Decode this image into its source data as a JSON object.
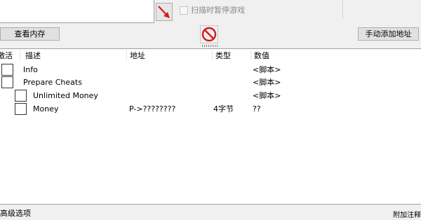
{
  "pause": {
    "label": "扫描时暂停游戏"
  },
  "buttons": {
    "memory_view": "查看内存",
    "add_address": "手动添加地址"
  },
  "columns": {
    "active": "激活",
    "description": "描述",
    "address": "地址",
    "type": "类型",
    "value": "数值"
  },
  "rows": [
    {
      "description": "Info",
      "address": "",
      "type": "",
      "value": "<脚本>",
      "indent": 0
    },
    {
      "description": "Prepare Cheats",
      "address": "",
      "type": "",
      "value": "<脚本>",
      "indent": 0
    },
    {
      "description": "Unlimited Money",
      "address": "",
      "type": "",
      "value": "<脚本>",
      "indent": 1
    },
    {
      "description": "Money",
      "address": "P->????????",
      "type": "4字节",
      "value": "??",
      "indent": 1
    }
  ],
  "footer": {
    "advanced_options": "高级选项",
    "table_extras": "附加注释"
  },
  "icons": {
    "pointer_arrow": "red-diagonal-arrow-icon",
    "stop": "red-no-entry-icon"
  },
  "colors": {
    "accent_red": "#d61a1a"
  }
}
